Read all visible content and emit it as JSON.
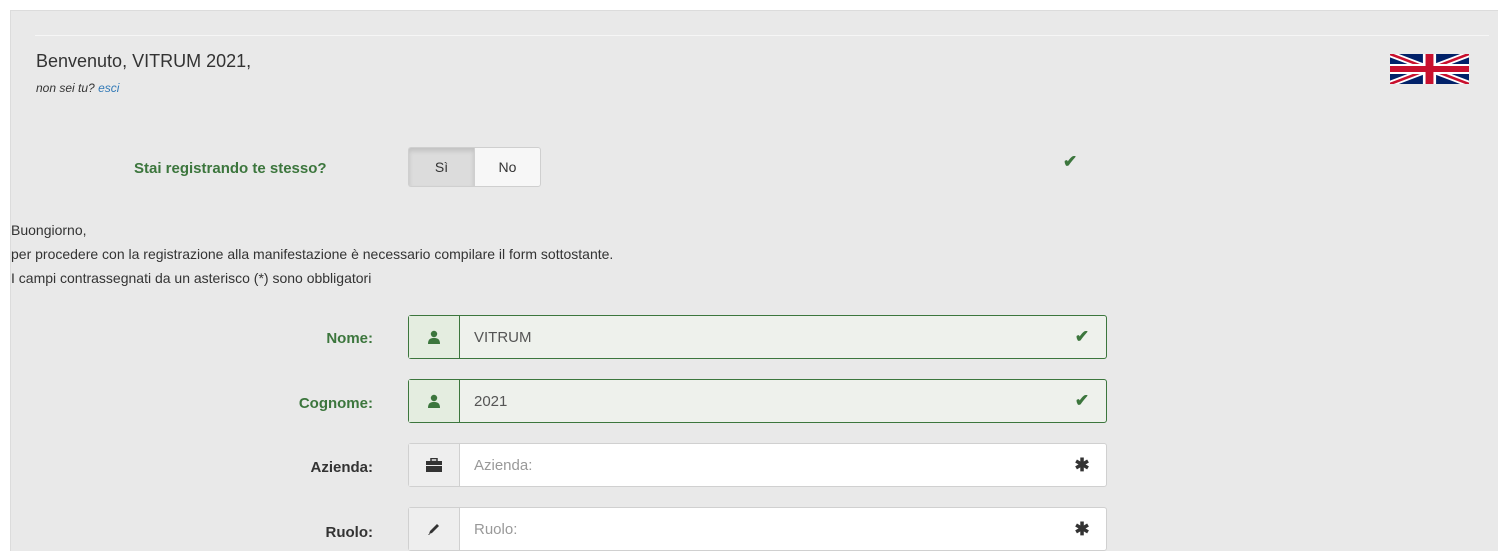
{
  "header": {
    "welcome": "Benvenuto, VITRUM 2021,",
    "not_you": "non sei tu?",
    "logout": "esci"
  },
  "question": {
    "label": "Stai registrando te stesso?",
    "yes": "Sì",
    "no": "No",
    "selected": "Sì"
  },
  "intro": {
    "line1": "Buongiorno,",
    "line2": "per procedere con la registrazione alla manifestazione è necessario compilare il form sottostante.",
    "line3": "I campi contrassegnati da un asterisco (*) sono obbligatori"
  },
  "fields": {
    "nome": {
      "label": "Nome:",
      "value": "VITRUM",
      "placeholder": "",
      "icon": "user-icon",
      "status": "valid"
    },
    "cognome": {
      "label": "Cognome:",
      "value": "2021",
      "placeholder": "",
      "icon": "user-icon",
      "status": "valid"
    },
    "azienda": {
      "label": "Azienda:",
      "value": "",
      "placeholder": "Azienda:",
      "icon": "briefcase-icon",
      "status": "required"
    },
    "ruolo": {
      "label": "Ruolo:",
      "value": "",
      "placeholder": "Ruolo:",
      "icon": "pencil-icon",
      "status": "required"
    }
  },
  "colors": {
    "success": "#3c763d",
    "link": "#337ab7",
    "panel": "#e9e9e9"
  }
}
